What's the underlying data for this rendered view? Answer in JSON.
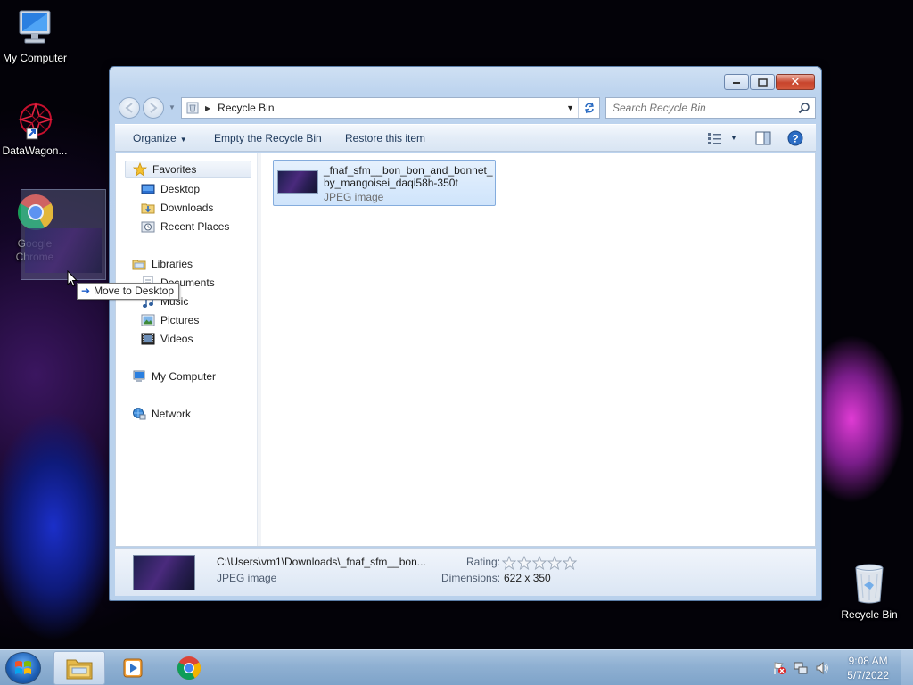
{
  "desktop": {
    "icons": [
      {
        "label": "My Computer",
        "icon": "monitor-icon"
      },
      {
        "label": "DataWagon...",
        "icon": "datawagon-icon"
      },
      {
        "label": "Google Chrome",
        "icon": "chrome-icon"
      },
      {
        "label": "Recycle Bin",
        "icon": "recycle-bin-icon"
      }
    ],
    "drag_tooltip": "Move to Desktop"
  },
  "window": {
    "address": {
      "location": "Recycle Bin"
    },
    "search": {
      "placeholder": "Search Recycle Bin"
    },
    "toolbar": {
      "organize": "Organize",
      "empty": "Empty the Recycle Bin",
      "restore": "Restore this item"
    },
    "nav": {
      "favorites": "Favorites",
      "desktop": "Desktop",
      "downloads": "Downloads",
      "recent": "Recent Places",
      "libraries": "Libraries",
      "documents": "Documents",
      "music": "Music",
      "pictures": "Pictures",
      "videos": "Videos",
      "computer": "My Computer",
      "network": "Network"
    },
    "file": {
      "name_line1": "_fnaf_sfm__bon_bon_and_bonnet_",
      "name_line2": "by_mangoisei_daqi58h-350t",
      "type": "JPEG image"
    },
    "details": {
      "path": "C:\\Users\\vm1\\Downloads\\_fnaf_sfm__bon...",
      "type": "JPEG image",
      "rating_label": "Rating:",
      "rating_value": 0,
      "rating_max": 5,
      "dimensions_label": "Dimensions:",
      "dimensions_value": "622 x 350"
    }
  },
  "taskbar": {
    "time": "9:08 AM",
    "date": "5/7/2022",
    "pinned": [
      "explorer-icon",
      "media-player-icon",
      "chrome-icon"
    ]
  },
  "colors": {
    "accent": "#1e395b",
    "selection": "#cfe4fb",
    "taskbar": "#8fb0d2"
  }
}
